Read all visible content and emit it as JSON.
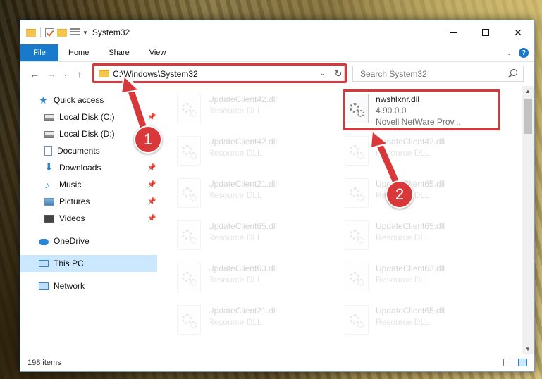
{
  "window": {
    "title": "System32",
    "controls": {
      "minimize": "–",
      "maximize": "□",
      "close": "✕"
    }
  },
  "ribbon": {
    "tabs": [
      "File",
      "Home",
      "Share",
      "View"
    ],
    "help": "?"
  },
  "address": {
    "path": "C:\\Windows\\System32",
    "search_placeholder": "Search System32"
  },
  "nav": {
    "items": [
      {
        "label": "Quick access",
        "icon": "star-icon"
      },
      {
        "label": "Local Disk (C:)",
        "icon": "disk-icon"
      },
      {
        "label": "Local Disk (D:)",
        "icon": "disk-icon"
      },
      {
        "label": "Documents",
        "icon": "document-icon"
      },
      {
        "label": "Downloads",
        "icon": "download-icon"
      },
      {
        "label": "Music",
        "icon": "music-icon"
      },
      {
        "label": "Pictures",
        "icon": "pictures-icon"
      },
      {
        "label": "Videos",
        "icon": "video-icon"
      },
      {
        "label": "OneDrive",
        "icon": "cloud-icon"
      },
      {
        "label": "This PC",
        "icon": "computer-icon"
      },
      {
        "label": "Network",
        "icon": "network-icon"
      }
    ]
  },
  "files": {
    "highlighted": {
      "name": "nwshlxnr.dll",
      "version": "4.90.0.0",
      "description": "Novell NetWare Prov..."
    },
    "left_column": [
      {
        "name": "UpdateClient42.dll",
        "type": "Resource DLL"
      },
      {
        "name": "UpdateClient42.dll",
        "type": "Resource DLL"
      },
      {
        "name": "UpdateClient21.dll",
        "type": "Resource DLL"
      },
      {
        "name": "UpdateClient65.dll",
        "type": "Resource DLL"
      },
      {
        "name": "UpdateClient63.dll",
        "type": "Resource DLL"
      },
      {
        "name": "UpdateClient21.dll",
        "type": "Resource DLL"
      }
    ],
    "right_column": [
      {
        "name": "UpdateClient42.dll",
        "type": "Resource DLL"
      },
      {
        "name": "UpdateClient65.dll",
        "type": "Resource DLL"
      },
      {
        "name": "UpdateClient65.dll",
        "type": "Resource DLL"
      },
      {
        "name": "UpdateClient63.dll",
        "type": "Resource DLL"
      },
      {
        "name": "UpdateClient65.dll",
        "type": "Resource DLL"
      }
    ]
  },
  "status": {
    "item_count": "198 items"
  },
  "callouts": {
    "step1": "1",
    "step2": "2"
  },
  "colors": {
    "accent": "#1979ca",
    "highlight": "#d9383a",
    "selection": "#cce8ff"
  }
}
